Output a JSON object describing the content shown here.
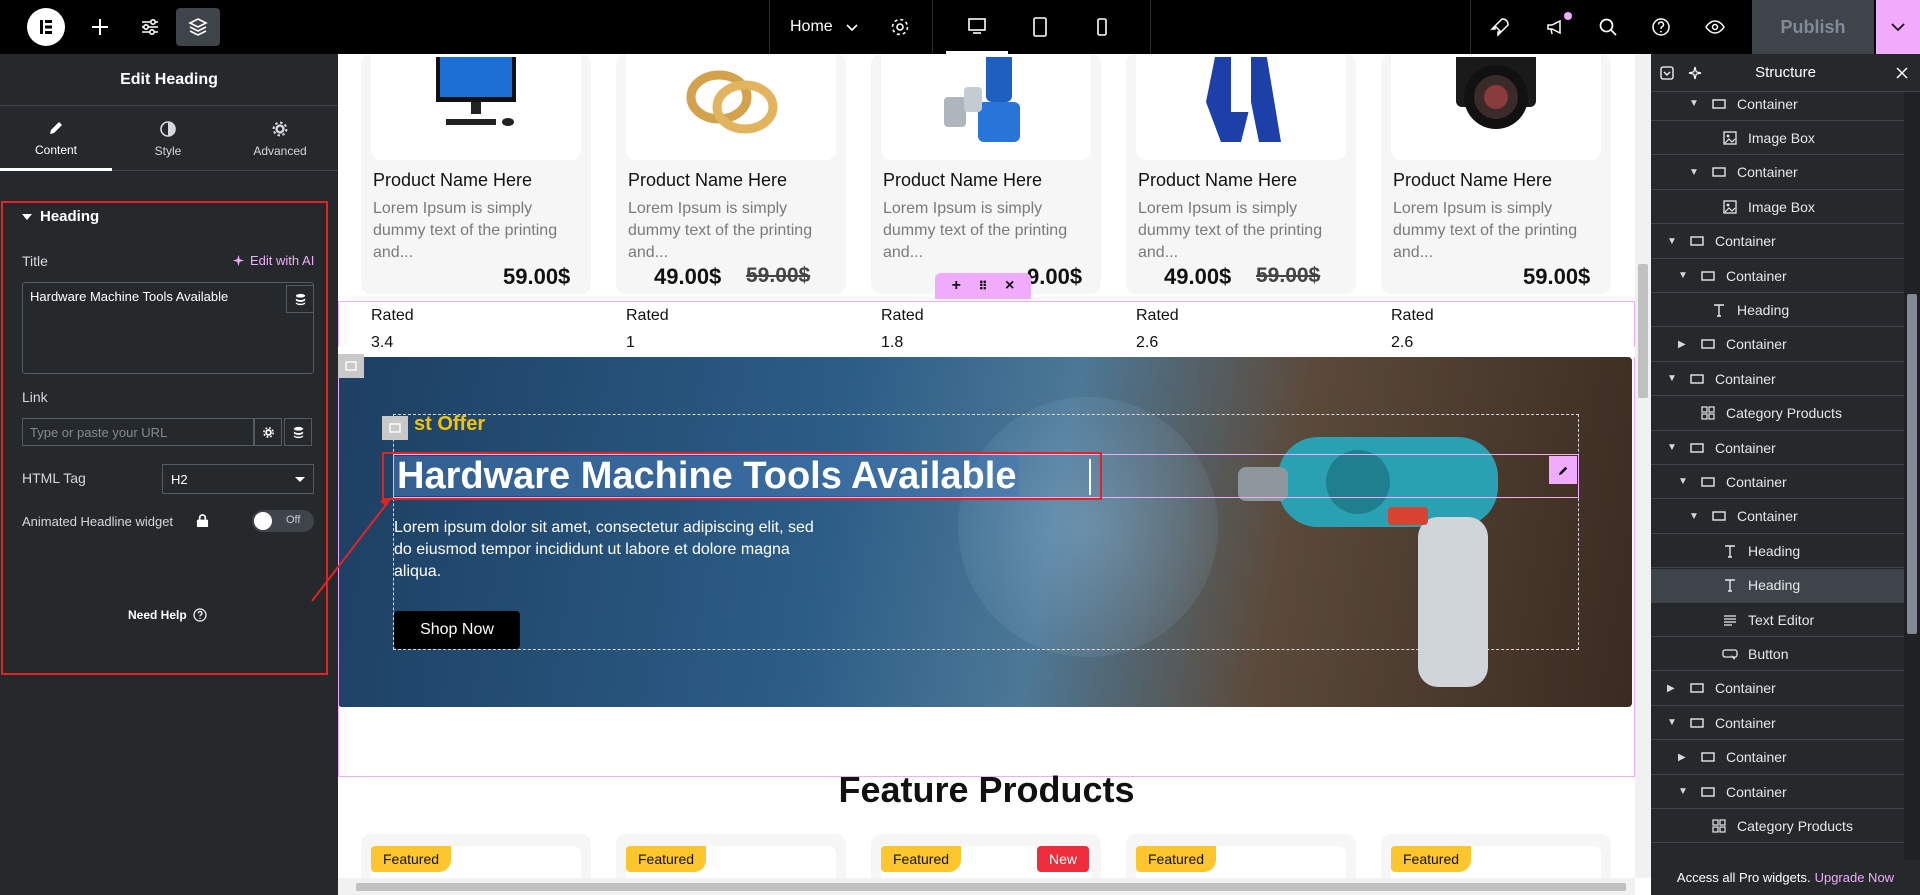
{
  "topbar": {
    "page_name": "Home",
    "publish_label": "Publish"
  },
  "left_panel": {
    "title": "Edit Heading",
    "tabs": [
      {
        "label": "Content",
        "icon": "pencil-icon"
      },
      {
        "label": "Style",
        "icon": "half-circle-icon"
      },
      {
        "label": "Advanced",
        "icon": "gear-icon"
      }
    ],
    "section_title": "Heading",
    "title_label": "Title",
    "edit_ai_label": "Edit with AI",
    "title_value": "Hardware Machine Tools Available",
    "link_label": "Link",
    "link_placeholder": "Type or paste your URL",
    "html_tag_label": "HTML Tag",
    "html_tag_value": "H2",
    "animated_label": "Animated Headline widget",
    "toggle_label": "Off",
    "need_help": "Need Help"
  },
  "canvas": {
    "products": [
      {
        "name": "Product Name Here",
        "desc": "Lorem Ipsum is simply dummy text of the printing and...",
        "price": "59.00$",
        "old_price": "",
        "rated_label": "Rated",
        "rating": "3.4"
      },
      {
        "name": "Product Name Here",
        "desc": "Lorem Ipsum is simply dummy text of the printing and...",
        "price": "49.00$",
        "old_price": "59.00$",
        "rated_label": "Rated",
        "rating": "1"
      },
      {
        "name": "Product Name Here",
        "desc": "Lorem Ipsum is simply dummy text of the printing and...",
        "price": "9.00$",
        "old_price": "",
        "rated_label": "Rated",
        "rating": "1.8"
      },
      {
        "name": "Product Name Here",
        "desc": "Lorem Ipsum is simply dummy text of the printing and...",
        "price": "49.00$",
        "old_price": "59.00$",
        "rated_label": "Rated",
        "rating": "2.6"
      },
      {
        "name": "Product Name Here",
        "desc": "Lorem Ipsum is simply dummy text of the printing and...",
        "price": "59.00$",
        "old_price": "",
        "rated_label": "Rated",
        "rating": "2.6"
      }
    ],
    "hero": {
      "offer": "st Offer",
      "title": "Hardware Machine Tools Available",
      "text": "Lorem ipsum dolor sit amet, consectetur adipiscing elit, sed do eiusmod tempor incididunt ut labore et dolore magna aliqua.",
      "button": "Shop Now"
    },
    "feature_title": "Feature Products",
    "feature_badges": [
      {
        "badge": "Featured",
        "extra": ""
      },
      {
        "badge": "Featured",
        "extra": ""
      },
      {
        "badge": "Featured",
        "extra": "New"
      },
      {
        "badge": "Featured",
        "extra": ""
      },
      {
        "badge": "Featured",
        "extra": ""
      }
    ]
  },
  "right_panel": {
    "title": "Structure",
    "nodes": [
      {
        "label": "Container",
        "type": "container",
        "depth": 2,
        "caret": "down"
      },
      {
        "label": "Image Box",
        "type": "imagebox",
        "depth": 3,
        "caret": ""
      },
      {
        "label": "Container",
        "type": "container",
        "depth": 2,
        "caret": "down"
      },
      {
        "label": "Image Box",
        "type": "imagebox",
        "depth": 3,
        "caret": ""
      },
      {
        "label": "Container",
        "type": "container",
        "depth": 0,
        "caret": "down"
      },
      {
        "label": "Container",
        "type": "container",
        "depth": 1,
        "caret": "down"
      },
      {
        "label": "Heading",
        "type": "heading",
        "depth": 2,
        "caret": ""
      },
      {
        "label": "Container",
        "type": "container",
        "depth": 1,
        "caret": "right"
      },
      {
        "label": "Container",
        "type": "container",
        "depth": 0,
        "caret": "down"
      },
      {
        "label": "Category Products",
        "type": "grid",
        "depth": 1,
        "caret": ""
      },
      {
        "label": "Container",
        "type": "container",
        "depth": 0,
        "caret": "down"
      },
      {
        "label": "Container",
        "type": "container",
        "depth": 1,
        "caret": "down"
      },
      {
        "label": "Container",
        "type": "container",
        "depth": 2,
        "caret": "down"
      },
      {
        "label": "Heading",
        "type": "heading",
        "depth": 3,
        "caret": ""
      },
      {
        "label": "Heading",
        "type": "heading",
        "depth": 3,
        "caret": "",
        "selected": true
      },
      {
        "label": "Text Editor",
        "type": "text",
        "depth": 3,
        "caret": ""
      },
      {
        "label": "Button",
        "type": "button",
        "depth": 3,
        "caret": ""
      },
      {
        "label": "Container",
        "type": "container",
        "depth": 0,
        "caret": "right"
      },
      {
        "label": "Container",
        "type": "container",
        "depth": 0,
        "caret": "down"
      },
      {
        "label": "Container",
        "type": "container",
        "depth": 1,
        "caret": "right"
      },
      {
        "label": "Container",
        "type": "container",
        "depth": 1,
        "caret": "down"
      },
      {
        "label": "Category Products",
        "type": "grid",
        "depth": 2,
        "caret": ""
      }
    ],
    "footer_text": "Access all Pro widgets.",
    "footer_link": "Upgrade Now"
  },
  "colors": {
    "accent_pink": "#f0abfc",
    "highlight_red": "#e02424",
    "offer_yellow": "#f5c400",
    "featured_badge": "#fec62e",
    "new_badge": "#ee2d3c"
  }
}
